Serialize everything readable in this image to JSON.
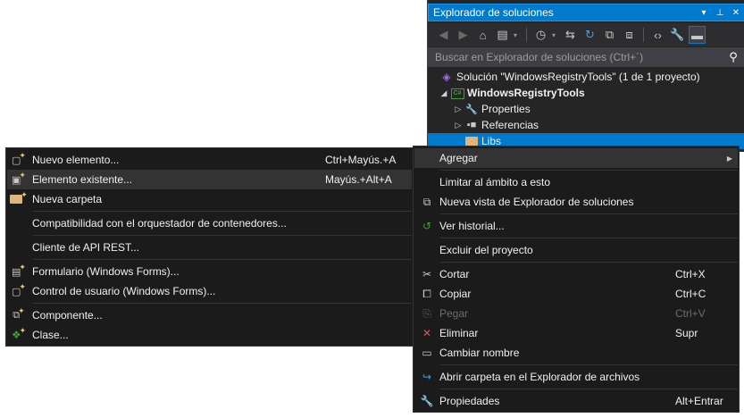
{
  "solution_explorer": {
    "title": "Explorador de soluciones",
    "window_controls": {
      "dropdown": "▾",
      "pin": "⊥",
      "close": "✕"
    },
    "search_placeholder": "Buscar en Explorador de soluciones (Ctrl+´)",
    "tree": [
      {
        "label": "Solución \"WindowsRegistryTools\" (1 de 1 proyecto)",
        "icon": "solution-icon"
      },
      {
        "label": "WindowsRegistryTools",
        "icon": "csharp-project-icon",
        "expanded": true
      },
      {
        "label": "Properties",
        "icon": "wrench-icon",
        "expanded": false
      },
      {
        "label": "Referencias",
        "icon": "references-icon",
        "expanded": false
      },
      {
        "label": "Libs",
        "icon": "folder-icon",
        "selected": true
      }
    ]
  },
  "context_menu": {
    "items": [
      {
        "label": "Agregar",
        "has_submenu": true,
        "highlighted": true
      },
      {
        "label": "Limitar al ámbito a esto"
      },
      {
        "label": "Nueva vista de Explorador de soluciones",
        "icon": "new-view-icon"
      },
      {
        "label": "Ver historial...",
        "icon": "history-icon"
      },
      {
        "label": "Excluir del proyecto"
      },
      {
        "label": "Cortar",
        "shortcut": "Ctrl+X",
        "icon": "scissors-icon"
      },
      {
        "label": "Copiar",
        "shortcut": "Ctrl+C",
        "icon": "copy-icon"
      },
      {
        "label": "Pegar",
        "shortcut": "Ctrl+V",
        "icon": "paste-icon",
        "disabled": true
      },
      {
        "label": "Eliminar",
        "shortcut": "Supr",
        "icon": "delete-icon"
      },
      {
        "label": "Cambiar nombre",
        "icon": "rename-icon"
      },
      {
        "label": "Abrir carpeta en el Explorador de archivos",
        "icon": "open-folder-icon"
      },
      {
        "label": "Propiedades",
        "shortcut": "Alt+Entrar",
        "icon": "wrench-icon"
      }
    ]
  },
  "add_submenu": {
    "items": [
      {
        "label": "Nuevo elemento...",
        "shortcut": "Ctrl+Mayús.+A",
        "icon": "new-item-icon"
      },
      {
        "label": "Elemento existente...",
        "shortcut": "Mayús.+Alt+A",
        "icon": "existing-item-icon",
        "highlighted": true
      },
      {
        "label": "Nueva carpeta",
        "icon": "new-folder-icon"
      },
      {
        "label": "Compatibilidad con el orquestador de contenedores..."
      },
      {
        "label": "Cliente de API REST..."
      },
      {
        "label": "Formulario (Windows Forms)...",
        "icon": "windows-form-icon"
      },
      {
        "label": "Control de usuario (Windows Forms)...",
        "icon": "user-control-icon"
      },
      {
        "label": "Componente...",
        "icon": "component-icon"
      },
      {
        "label": "Clase...",
        "icon": "class-icon"
      }
    ]
  },
  "colors": {
    "accent": "#007acc",
    "panel_background": "#252526",
    "menu_background": "#1b1b1c",
    "menu_highlight": "#333334"
  }
}
